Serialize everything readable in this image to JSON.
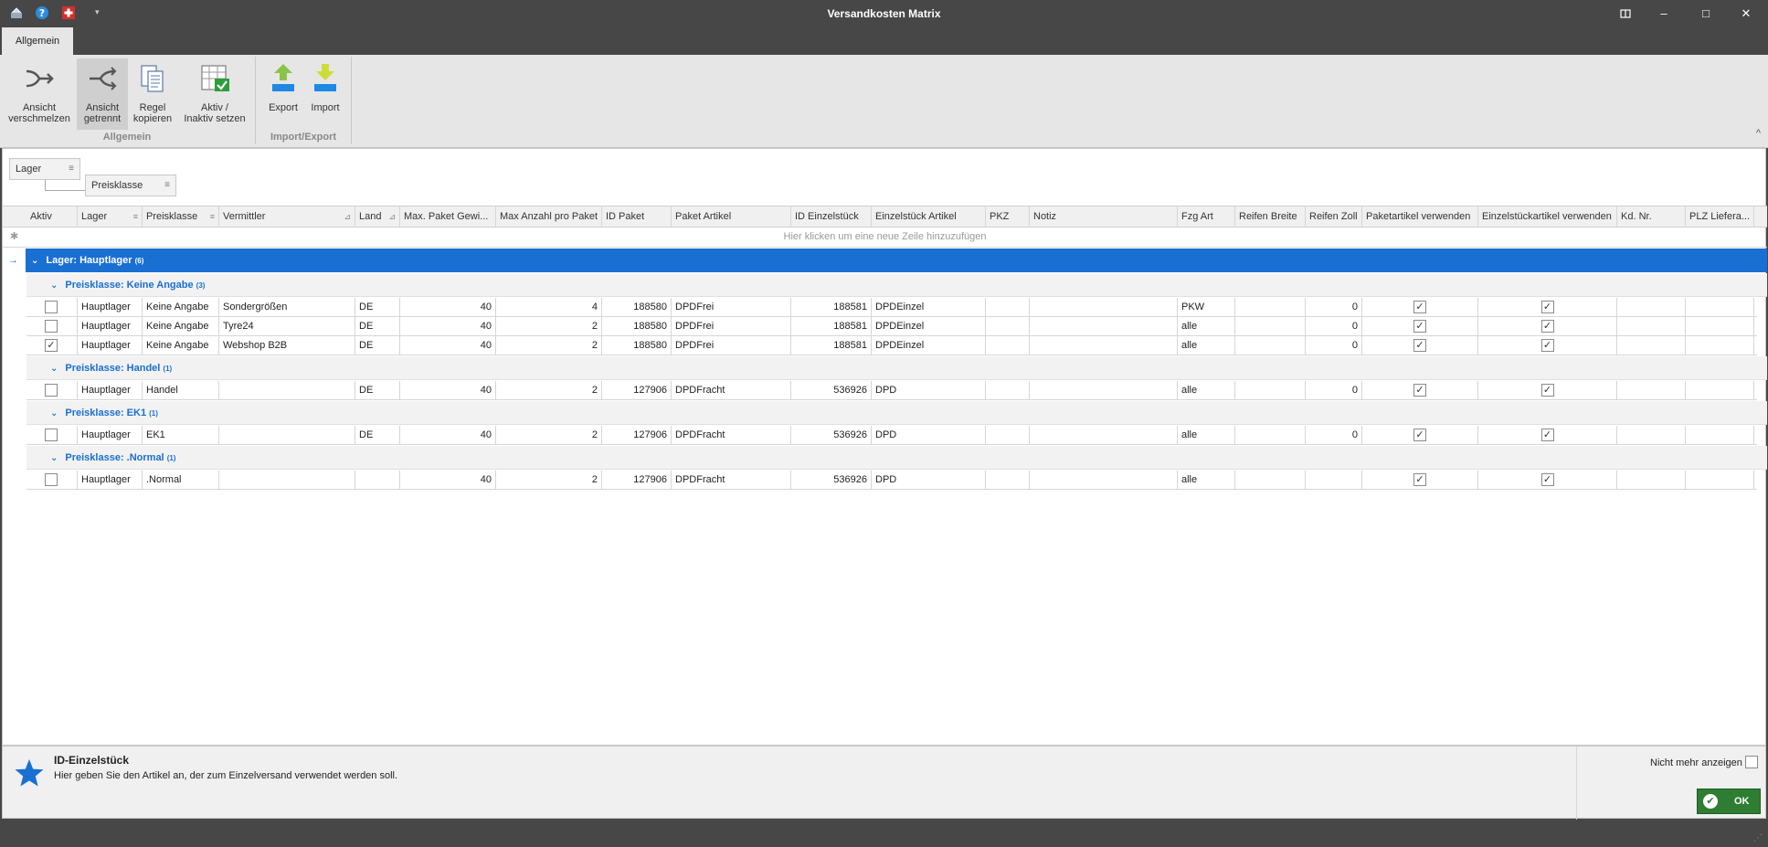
{
  "window": {
    "title": "Versandkosten Matrix",
    "restore_icon": "restore-icon",
    "min_label": "–",
    "max_label": "□",
    "close_label": "✕"
  },
  "ribbon": {
    "tab": "Allgemein",
    "buttons": [
      {
        "label": "Ansicht\nverschmelzen",
        "icon": "merge-icon"
      },
      {
        "label": "Ansicht\ngetrennt",
        "icon": "split-icon"
      },
      {
        "label": "Regel\nkopieren",
        "icon": "copy-icon"
      },
      {
        "label": "Aktiv /\nInaktiv setzen",
        "icon": "toggle-active-icon"
      },
      {
        "label": "Export",
        "icon": "export-icon"
      },
      {
        "label": "Import",
        "icon": "import-icon"
      }
    ],
    "groups": [
      "Allgemein",
      "Import/Export"
    ],
    "collapse": "^"
  },
  "group_panel": {
    "chips": [
      "Lager",
      "Preisklasse"
    ]
  },
  "grid": {
    "columns": [
      "Aktiv",
      "Lager",
      "Preisklasse",
      "Vermittler",
      "Land",
      "Max. Paket Gewi...",
      "Max Anzahl pro Paket",
      "ID Paket",
      "Paket Artikel",
      "ID Einzelstück",
      "Einzelstück Artikel",
      "PKZ",
      "Notiz",
      "Fzg Art",
      "Reifen Breite",
      "Reifen Zoll",
      "Paketartikel verwenden",
      "Einzelstückartikel verwenden",
      "Kd. Nr.",
      "PLZ Liefera..."
    ],
    "new_row_text": "Hier klicken um eine neue Zeile hinzuzufügen",
    "group_level1": {
      "label": "Lager: Hauptlager",
      "count": "(6)"
    },
    "groups": [
      {
        "label": "Preisklasse: Keine Angabe",
        "count": "(3)",
        "rows": [
          {
            "aktiv": false,
            "lager": "Hauptlager",
            "preisklasse": "Keine Angabe",
            "vermittler": "Sondergrößen",
            "land": "DE",
            "gewicht": "40",
            "anzahl": "4",
            "id_paket": "188580",
            "paket_artikel": "DPDFrei",
            "id_einzel": "188581",
            "einzel_artikel": "DPDEinzel",
            "pkz": "",
            "notiz": "",
            "fzg": "PKW",
            "breite": "",
            "zoll": "0",
            "paket_verw": true,
            "einzel_verw": true
          },
          {
            "aktiv": false,
            "lager": "Hauptlager",
            "preisklasse": "Keine Angabe",
            "vermittler": "Tyre24",
            "land": "DE",
            "gewicht": "40",
            "anzahl": "2",
            "id_paket": "188580",
            "paket_artikel": "DPDFrei",
            "id_einzel": "188581",
            "einzel_artikel": "DPDEinzel",
            "pkz": "",
            "notiz": "",
            "fzg": "alle",
            "breite": "",
            "zoll": "0",
            "paket_verw": true,
            "einzel_verw": true
          },
          {
            "aktiv": true,
            "lager": "Hauptlager",
            "preisklasse": "Keine Angabe",
            "vermittler": "Webshop B2B",
            "land": "DE",
            "gewicht": "40",
            "anzahl": "2",
            "id_paket": "188580",
            "paket_artikel": "DPDFrei",
            "id_einzel": "188581",
            "einzel_artikel": "DPDEinzel",
            "pkz": "",
            "notiz": "",
            "fzg": "alle",
            "breite": "",
            "zoll": "0",
            "paket_verw": true,
            "einzel_verw": true
          }
        ]
      },
      {
        "label": "Preisklasse: Handel",
        "count": "(1)",
        "rows": [
          {
            "aktiv": false,
            "lager": "Hauptlager",
            "preisklasse": "Handel",
            "vermittler": "",
            "land": "DE",
            "gewicht": "40",
            "anzahl": "2",
            "id_paket": "127906",
            "paket_artikel": "DPDFracht",
            "id_einzel": "536926",
            "einzel_artikel": "DPD",
            "pkz": "",
            "notiz": "",
            "fzg": "alle",
            "breite": "",
            "zoll": "0",
            "paket_verw": true,
            "einzel_verw": true
          }
        ]
      },
      {
        "label": "Preisklasse: EK1",
        "count": "(1)",
        "rows": [
          {
            "aktiv": false,
            "lager": "Hauptlager",
            "preisklasse": "EK1",
            "vermittler": "",
            "land": "DE",
            "gewicht": "40",
            "anzahl": "2",
            "id_paket": "127906",
            "paket_artikel": "DPDFracht",
            "id_einzel": "536926",
            "einzel_artikel": "DPD",
            "pkz": "",
            "notiz": "",
            "fzg": "alle",
            "breite": "",
            "zoll": "0",
            "paket_verw": true,
            "einzel_verw": true
          }
        ]
      },
      {
        "label": "Preisklasse: .Normal",
        "count": "(1)",
        "rows": [
          {
            "aktiv": false,
            "lager": "Hauptlager",
            "preisklasse": ".Normal",
            "vermittler": "",
            "land": "",
            "gewicht": "40",
            "anzahl": "2",
            "id_paket": "127906",
            "paket_artikel": "DPDFracht",
            "id_einzel": "536926",
            "einzel_artikel": "DPD",
            "pkz": "",
            "notiz": "",
            "fzg": "alle",
            "breite": "",
            "zoll": "",
            "paket_verw": true,
            "einzel_verw": true
          }
        ]
      }
    ]
  },
  "help": {
    "title": "ID-Einzelstück",
    "text": "Hier geben Sie den Artikel an, der zum Einzelversand verwendet werden soll.",
    "nomore": "Nicht mehr anzeigen",
    "ok": "OK"
  },
  "colors": {
    "accent": "#1a6fd3",
    "ok_green": "#2e7d32",
    "chrome": "#474747"
  }
}
